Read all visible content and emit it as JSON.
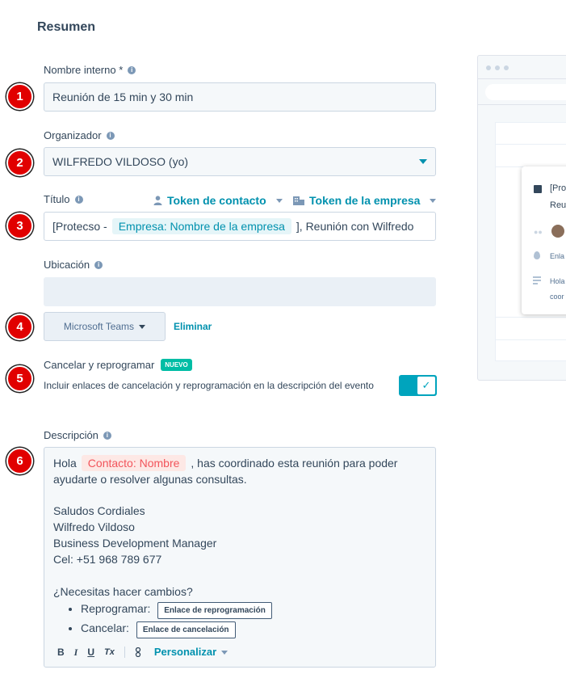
{
  "page": {
    "title": "Resumen"
  },
  "steps": [
    "1",
    "2",
    "3",
    "4",
    "5",
    "6"
  ],
  "internal_name": {
    "label": "Nombre interno *",
    "value": "Reunión de 15 min y 30 min"
  },
  "organizer": {
    "label": "Organizador",
    "value": "WILFREDO VILDOSO (yo)"
  },
  "title_field": {
    "label": "Título",
    "contact_token": "Token de contacto",
    "company_token": "Token de la empresa",
    "prefix": "[Protecso -",
    "token": "Empresa: Nombre de la empresa",
    "suffix": "], Reunión con Wilfredo"
  },
  "location": {
    "label": "Ubicación",
    "value": "",
    "provider_button": "Microsoft Teams",
    "remove_link": "Eliminar"
  },
  "cancel_reschedule": {
    "label": "Cancelar y reprogramar",
    "badge": "NUEVO",
    "description": "Incluir enlaces de cancelación y reprogramación en la descripción del evento",
    "enabled": true
  },
  "description": {
    "label": "Descripción",
    "greeting": "Hola",
    "contact_token": "Contacto: Nombre",
    "line1_rest": ", has coordinado esta reunión para poder ayudarte o resolver algunas consultas.",
    "signature": [
      "Saludos Cordiales",
      "Wilfredo Vildoso",
      "Business Development Manager",
      "Cel: +51 968 789 677"
    ],
    "question": "¿Necesitas hacer cambios?",
    "reschedule_label": "Reprogramar:",
    "reschedule_link": "Enlace de reprogramación",
    "cancel_label": "Cancelar:",
    "cancel_link": "Enlace de cancelación",
    "toolbar": {
      "bold": "B",
      "italic": "I",
      "underline": "U",
      "clear": "Tx",
      "personalize": "Personalizar"
    }
  },
  "preview": {
    "title_line1": "[Pro",
    "title_line2": "Reu",
    "location_text": "Enla",
    "desc_line1": "Hola",
    "desc_line2": "coor"
  },
  "colors": {
    "accent": "#0091ae",
    "step_badge": "#e10000",
    "toggle_on": "#00a4bd",
    "nuevo_badge": "#00bda5"
  }
}
